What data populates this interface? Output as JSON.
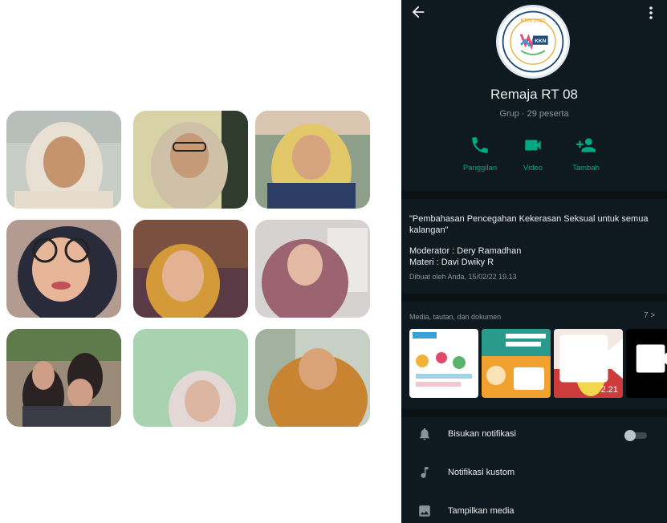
{
  "group": {
    "title": "Remaja RT 08",
    "subtitle": "Grup · 29 peserta",
    "logo_text": "KKN 2022",
    "logo_badge": "KKN"
  },
  "actions": [
    {
      "label": "Panggilan",
      "icon": "phone-icon"
    },
    {
      "label": "Video",
      "icon": "video-icon"
    },
    {
      "label": "Tambah",
      "icon": "add-person-icon"
    }
  ],
  "description": {
    "text": "\"Pembahasan Pencegahan Kekerasan Seksual untuk semua kalangan\"",
    "moderator": "Moderator : Dery Ramadhan",
    "materi": "Materi : Davi Dwiky R",
    "created": "Dibuat oleh Anda, 15/02/22 19.13"
  },
  "media": {
    "title": "Media, tautan, dan dokumen",
    "count": "7 >",
    "video_duration": "2.21"
  },
  "settings": [
    {
      "label": "Bisukan notifikasi",
      "icon": "bell-icon",
      "toggle": false
    },
    {
      "label": "Notifikasi kustom",
      "icon": "music-note-icon"
    },
    {
      "label": "Tampilkan media",
      "icon": "image-icon"
    }
  ],
  "colors": {
    "accent": "#00a884",
    "background": "#0f1a20",
    "text_secondary": "#8696a0"
  }
}
